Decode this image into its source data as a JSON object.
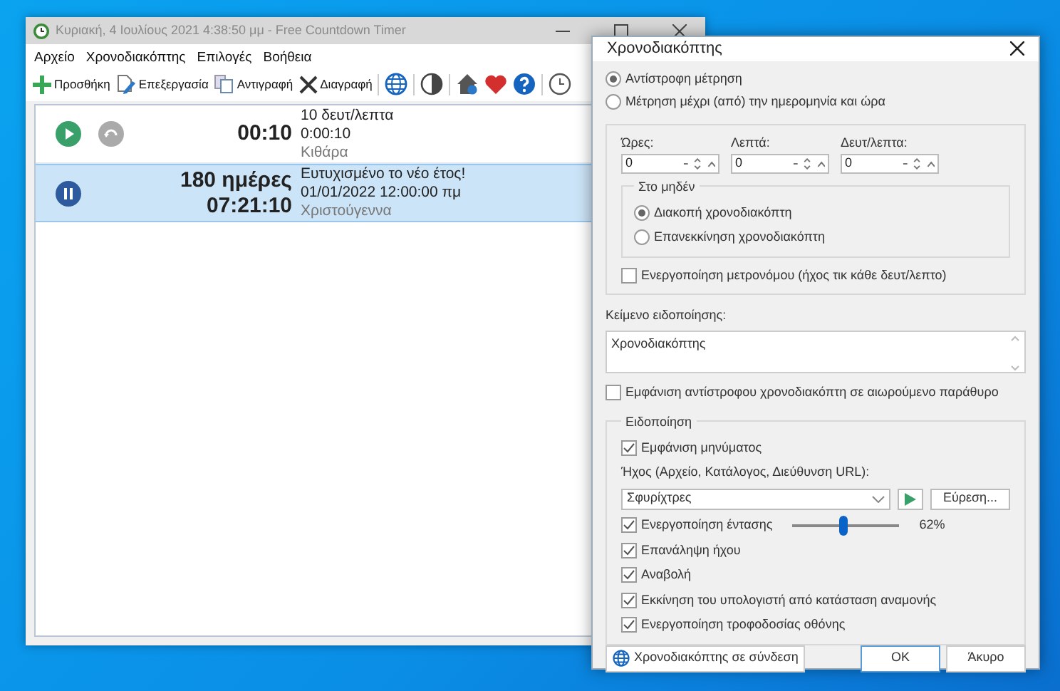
{
  "main_window": {
    "title": "Κυριακή, 4 Ιουλίους 2021 4:38:50 μμ - Free Countdown Timer",
    "menu": [
      "Αρχείο",
      "Χρονοδιακόπτης",
      "Επιλογές",
      "Βοήθεια"
    ],
    "toolbar": [
      {
        "kind": "add",
        "label": "Προσθήκη"
      },
      {
        "kind": "edit",
        "label": "Επεξεργασία"
      },
      {
        "kind": "copy",
        "label": "Αντιγραφή"
      },
      {
        "kind": "delete",
        "label": "Διαγραφή"
      },
      {
        "kind": "separator"
      },
      {
        "kind": "globe"
      },
      {
        "kind": "separator"
      },
      {
        "kind": "contrast"
      },
      {
        "kind": "separator"
      },
      {
        "kind": "home"
      },
      {
        "kind": "heart"
      },
      {
        "kind": "help"
      },
      {
        "kind": "separator"
      },
      {
        "kind": "clock"
      }
    ],
    "timers": [
      {
        "running": false,
        "selected": false,
        "time": [
          "00:10"
        ],
        "lines": [
          "10 δευτ/λεπτα",
          "0:00:10",
          "Κιθάρα"
        ]
      },
      {
        "running": true,
        "selected": true,
        "time": [
          "180 ημέρες",
          "07:21:10"
        ],
        "lines": [
          "Ευτυχισμένο το νέο έτος!",
          "01/01/2022 12:00:00 πμ",
          "Χριστούγεννα"
        ]
      }
    ]
  },
  "dialog": {
    "title": "Χρονοδιακόπτης",
    "modes": [
      {
        "label": "Αντίστροφη μέτρηση",
        "selected": true
      },
      {
        "label": "Μέτρηση μέχρι (από) την ημερομηνία και ώρα",
        "selected": false
      }
    ],
    "fields": [
      {
        "label": "Ώρες:",
        "value": "0"
      },
      {
        "label": "Λεπτά:",
        "value": "0"
      },
      {
        "label": "Δευτ/λεπτα:",
        "value": "0"
      }
    ],
    "at_zero": {
      "legend": "Στο μηδέν",
      "options": [
        {
          "label": "Διακοπή χρονοδιακόπτη",
          "selected": true
        },
        {
          "label": "Επανεκκίνηση χρονοδιακόπτη",
          "selected": false
        }
      ]
    },
    "metronome": {
      "label": "Ενεργοποίηση μετρονόμου (ήχος τικ κάθε δευτ/λεπτο)",
      "checked": false
    },
    "message": {
      "label": "Κείμενο ειδοποίησης:",
      "value": "Χρονοδιακόπτης"
    },
    "floating": {
      "label": "Εμφάνιση αντίστροφου χρονοδιακόπτη σε αιωρούμενο παράθυρο",
      "checked": false
    },
    "notification": {
      "legend": "Ειδοποίηση",
      "show_message": {
        "label": "Εμφάνιση μηνύματος",
        "checked": true
      },
      "sound_label": "Ήχος (Αρχείο, Κατάλογος, Διεύθυνση URL):",
      "sound": "Σφυρίχτρες",
      "browse": "Εύρεση...",
      "options": [
        {
          "kind": "slider",
          "label": "Ενεργοποίηση έντασης",
          "checked": true,
          "level": 0.48,
          "reading": "62%"
        },
        {
          "kind": "check",
          "label": "Επανάληψη ήχου",
          "checked": true
        },
        {
          "kind": "check",
          "label": "Αναβολή",
          "checked": true
        },
        {
          "kind": "check",
          "label": "Εκκίνηση του υπολογιστή από κατάσταση αναμονής",
          "checked": true
        },
        {
          "kind": "check",
          "label": "Ενεργοποίηση τροφοδοσίας οθόνης",
          "checked": true
        }
      ]
    },
    "online": "Χρονοδιακόπτης σε σύνδεση",
    "ok": "OK",
    "cancel": "Άκυρο"
  }
}
